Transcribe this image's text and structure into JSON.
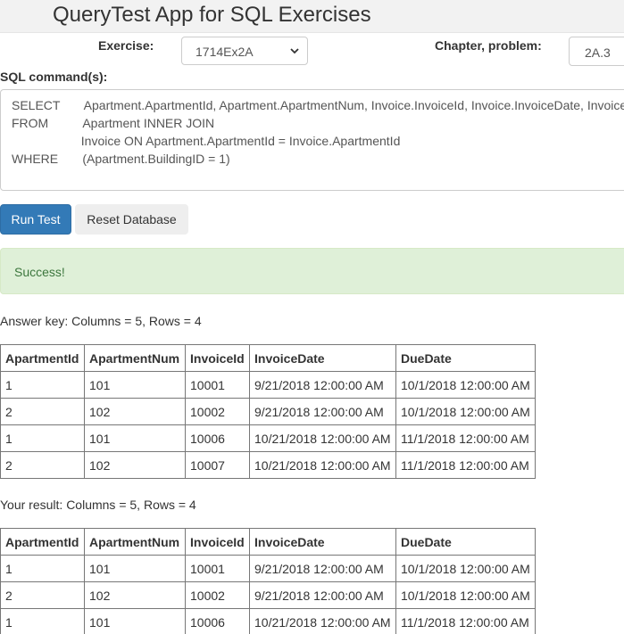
{
  "app": {
    "title": "QueryTest App for SQL Exercises"
  },
  "exercise": {
    "label": "Exercise:",
    "selected": "1714Ex2A"
  },
  "chapter": {
    "label": "Chapter, problem:",
    "value": "2A.3"
  },
  "sql": {
    "label": "SQL command(s):",
    "lines": [
      "SELECT       Apartment.ApartmentId, Apartment.ApartmentNum, Invoice.InvoiceId, Invoice.InvoiceDate, Invoice.DueDate",
      "FROM          Apartment INNER JOIN",
      "                    Invoice ON Apartment.ApartmentId = Invoice.ApartmentId",
      "WHERE       (Apartment.BuildingID = 1)"
    ]
  },
  "buttons": {
    "run_label": "Run Test",
    "reset_label": "Reset Database"
  },
  "alert": {
    "text": "Success!"
  },
  "answer_key": {
    "caption": "Answer key: Columns = 5, Rows = 4",
    "columns": [
      "ApartmentId",
      "ApartmentNum",
      "InvoiceId",
      "InvoiceDate",
      "DueDate"
    ],
    "rows": [
      [
        "1",
        "101",
        "10001",
        "9/21/2018 12:00:00 AM",
        "10/1/2018 12:00:00 AM"
      ],
      [
        "2",
        "102",
        "10002",
        "9/21/2018 12:00:00 AM",
        "10/1/2018 12:00:00 AM"
      ],
      [
        "1",
        "101",
        "10006",
        "10/21/2018 12:00:00 AM",
        "11/1/2018 12:00:00 AM"
      ],
      [
        "2",
        "102",
        "10007",
        "10/21/2018 12:00:00 AM",
        "11/1/2018 12:00:00 AM"
      ]
    ]
  },
  "your_result": {
    "caption": "Your result: Columns = 5, Rows = 4",
    "columns": [
      "ApartmentId",
      "ApartmentNum",
      "InvoiceId",
      "InvoiceDate",
      "DueDate"
    ],
    "rows": [
      [
        "1",
        "101",
        "10001",
        "9/21/2018 12:00:00 AM",
        "10/1/2018 12:00:00 AM"
      ],
      [
        "2",
        "102",
        "10002",
        "9/21/2018 12:00:00 AM",
        "10/1/2018 12:00:00 AM"
      ],
      [
        "1",
        "101",
        "10006",
        "10/21/2018 12:00:00 AM",
        "11/1/2018 12:00:00 AM"
      ]
    ]
  },
  "icons": {
    "select_chevron": "chevron-down-icon"
  },
  "colors": {
    "primary": "#337ab7",
    "success_bg": "#dff0d8",
    "success_text": "#3c763d"
  }
}
